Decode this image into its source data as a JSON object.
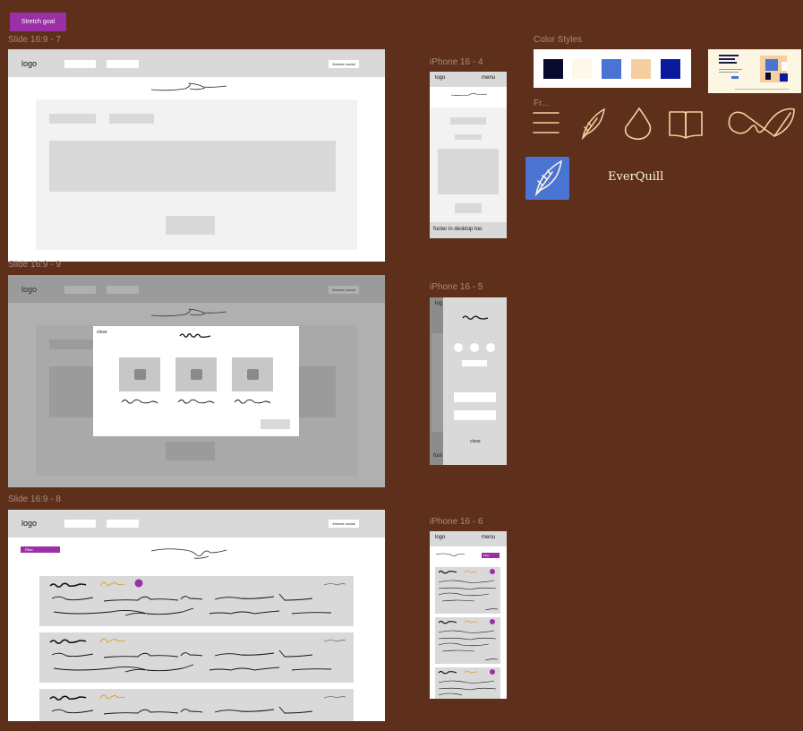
{
  "stretch_goal_label": "Stretch goal",
  "frames": {
    "slide7": "Slide 16:9 - 7",
    "slide9": "Slide 16:9 - 9",
    "slide8": "Slide 16:9 - 8",
    "iphone4": "iPhone 16 - 4",
    "iphone5": "iPhone 16 - 5",
    "iphone6": "iPhone 16 - 6",
    "color_styles": "Color Styles",
    "icons_frame": "Fr..."
  },
  "wireframe": {
    "logo": "logo",
    "themes_modal": "themes modal",
    "menu": "menu",
    "footer_note": "footer in desktop too",
    "close": "close",
    "filter": "Filter",
    "footer_short": "foot",
    "logo_short": "log"
  },
  "brand": {
    "name": "EverQuill",
    "icon_bg": "#4a74d3"
  },
  "colors": [
    "#0a0a2e",
    "#fdf8e8",
    "#4a74d3",
    "#f5cfa0",
    "#0a1a9e"
  ],
  "icons": [
    "menu-icon",
    "feather-icon",
    "drop-icon",
    "book-icon",
    "quill-signature-icon"
  ]
}
